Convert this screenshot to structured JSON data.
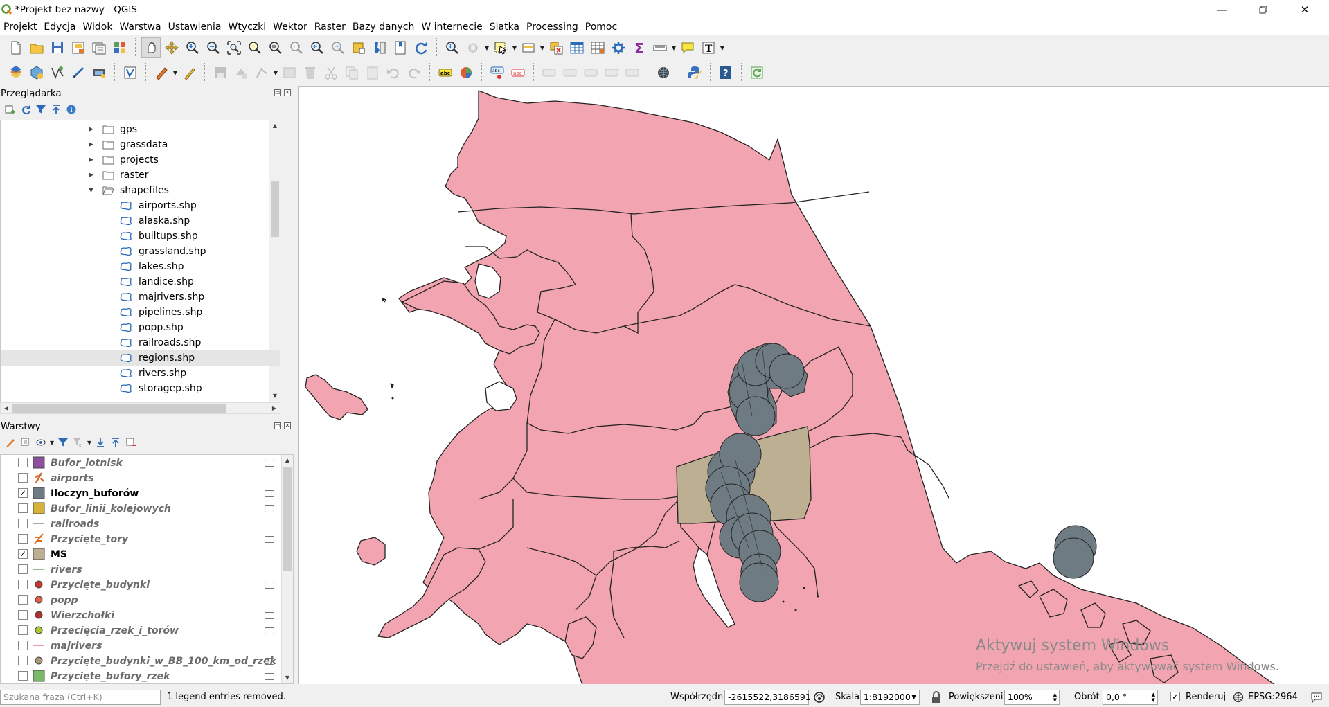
{
  "window": {
    "title": "*Projekt bez nazwy - QGIS"
  },
  "menu": [
    "Projekt",
    "Edycja",
    "Widok",
    "Warstwa",
    "Ustawienia",
    "Wtyczki",
    "Wektor",
    "Raster",
    "Bazy danych",
    "W internecie",
    "Siatka",
    "Processing",
    "Pomoc"
  ],
  "browser": {
    "title": "Przeglądarka",
    "folders": [
      "gps",
      "grassdata",
      "projects",
      "raster",
      "shapefiles"
    ],
    "files": [
      "airports.shp",
      "alaska.shp",
      "builtups.shp",
      "grassland.shp",
      "lakes.shp",
      "landice.shp",
      "majrivers.shp",
      "pipelines.shp",
      "popp.shp",
      "railroads.shp",
      "regions.shp",
      "rivers.shp",
      "storagep.shp"
    ],
    "selected": "regions.shp"
  },
  "layers": {
    "title": "Warstwy",
    "items": [
      {
        "name": "Bufor_lotnisk",
        "checked": false,
        "symbol": "square",
        "color": "#8e4f9e",
        "legend": true
      },
      {
        "name": "airports",
        "checked": false,
        "symbol": "airport",
        "color": "#d8642a",
        "legend": false
      },
      {
        "name": "Iloczyn_buforów",
        "checked": true,
        "symbol": "square",
        "color": "#6f7b82",
        "legend": true
      },
      {
        "name": "Bufor_linii_kolejowych",
        "checked": false,
        "symbol": "square",
        "color": "#d6b23a",
        "legend": true
      },
      {
        "name": "railroads",
        "checked": false,
        "symbol": "line",
        "color": "#8a8a8a",
        "legend": false
      },
      {
        "name": "Przycięte_tory",
        "checked": false,
        "symbol": "rail",
        "color": "#e06a1a",
        "legend": true
      },
      {
        "name": "MS",
        "checked": true,
        "symbol": "square",
        "color": "#bdb092",
        "legend": false
      },
      {
        "name": "rivers",
        "checked": false,
        "symbol": "line",
        "color": "#6aa56a",
        "legend": false
      },
      {
        "name": "Przycięte_budynki",
        "checked": false,
        "symbol": "dot",
        "color": "#c0392b",
        "legend": true
      },
      {
        "name": "popp",
        "checked": false,
        "symbol": "dot",
        "color": "#e0604a",
        "legend": false
      },
      {
        "name": "Wierzchołki",
        "checked": false,
        "symbol": "dot",
        "color": "#b03030",
        "legend": true
      },
      {
        "name": "Przecięcia_rzek_i_torów",
        "checked": false,
        "symbol": "dot",
        "color": "#a8c83a",
        "legend": true
      },
      {
        "name": "majrivers",
        "checked": false,
        "symbol": "line",
        "color": "#e07a8a",
        "legend": false
      },
      {
        "name": "Przycięte_budynki_w_BB_100_km_od_rzek",
        "checked": false,
        "symbol": "dot",
        "color": "#a89a7a",
        "legend": true
      },
      {
        "name": "Przycięte_bufory_rzek",
        "checked": false,
        "symbol": "square",
        "color": "#7ab86a",
        "legend": true
      }
    ]
  },
  "status": {
    "search_placeholder": "Szukana fraza (Ctrl+K)",
    "message": "1 legend entries removed.",
    "coord_label": "Współrzędne",
    "coord_value": "-2615522,3186591",
    "scale_label": "Skala",
    "scale_value": "1:8192000",
    "magnifier_label": "Powiększenie",
    "magnifier_value": "100%",
    "rotation_label": "Obrót",
    "rotation_value": "0,0 °",
    "render_label": "Renderuj",
    "render_checked": "✓",
    "crs": "EPSG:2964"
  },
  "watermark": {
    "line1": "Aktywuj system Windows",
    "line2": "Przejdź do ustawień, aby aktywować system Windows."
  },
  "colors": {
    "land": "#f2a5b0",
    "ms_region": "#bdb092",
    "buffer": "#6f7b82",
    "outline": "#222222"
  }
}
